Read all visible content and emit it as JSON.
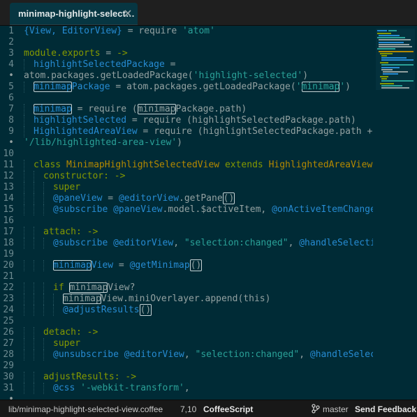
{
  "tab": {
    "title": "minimap-highlight-select…",
    "close_icon": "close-icon"
  },
  "gutter": {
    "lines": [
      "1",
      "2",
      "3",
      "4",
      "•",
      "5",
      "6",
      "7",
      "8",
      "9",
      "•",
      "10",
      "11",
      "12",
      "13",
      "14",
      "15",
      "16",
      "17",
      "18",
      "19",
      "20",
      "21",
      "22",
      "23",
      "24",
      "25",
      "26",
      "27",
      "28",
      "29",
      "30",
      "31",
      "•"
    ]
  },
  "code": {
    "l1": {
      "a": "{View, EditorView}",
      "b": " = require ",
      "c": "'atom'"
    },
    "l3": {
      "a": "module.exports",
      "b": " = ",
      "c": "->"
    },
    "l4": {
      "a": "highlightSelectedPackage",
      "b": " ="
    },
    "l4w": {
      "a": "atom.packages.getLoadedPackage(",
      "b": "'highlight-selected'",
      "c": ")"
    },
    "l5": {
      "a": "minimap",
      "b": "Package",
      "c": " = atom.packages.getLoadedPackage(",
      "d": "'",
      "e": "minimap",
      "f": "'",
      "g": ")"
    },
    "l7": {
      "a": "minimap",
      "b": " = require ",
      "c": "(",
      "d": "minimap",
      "e": "Package.path)"
    },
    "l8": {
      "a": "highlightSelected",
      "b": " = require (highlightSelectedPackage.path)"
    },
    "l9": {
      "a": "HighlightedAreaView",
      "b": " = require (highlightSelectedPackage.path +"
    },
    "l9w": {
      "a": "'/lib/highlighted-area-view'",
      "b": ")"
    },
    "l11": {
      "a": "class ",
      "b": "MinimapHighlightSelectedView",
      "c": " extends ",
      "d": "HighlightedAreaView"
    },
    "l12": {
      "a": "constructor:",
      "b": " ->"
    },
    "l13": {
      "a": "super"
    },
    "l14": {
      "a": "@paneView",
      "b": " = ",
      "c": "@editorView",
      "d": ".getPane",
      "e": "()"
    },
    "l15": {
      "a": "@subscribe ",
      "b": "@paneView",
      "c": ".model.$activeItem, ",
      "d": "@onActiveItemChanged"
    },
    "l17": {
      "a": "attach:",
      "b": " ->"
    },
    "l18": {
      "a": "@subscribe ",
      "b": "@editorView",
      "c": ", ",
      "d": "\"selection:changed\"",
      "e": ", ",
      "f": "@handleSelection"
    },
    "l20": {
      "a": "minimap",
      "b": "View",
      "c": " = ",
      "d": "@getMinimap",
      "e": "()"
    },
    "l22": {
      "a": "if ",
      "b": "minimap",
      "c": "View?"
    },
    "l23": {
      "a": "minimap",
      "b": "View.miniOverlayer.append(this)"
    },
    "l24": {
      "a": "@adjustResults",
      "b": "()"
    },
    "l26": {
      "a": "detach:",
      "b": " ->"
    },
    "l27": {
      "a": "super"
    },
    "l28": {
      "a": "@unsubscribe ",
      "b": "@editorView",
      "c": ", ",
      "d": "\"selection:changed\"",
      "e": ", ",
      "f": "@handleSelection"
    },
    "l30": {
      "a": "adjustResults:",
      "b": " ->"
    },
    "l31": {
      "a": "@css ",
      "b": "'-webkit-transform'",
      "c": ","
    }
  },
  "status": {
    "path": "lib/minimap-highlight-selected-view.coffee",
    "cursor": "7,10",
    "grammar": "CoffeeScript",
    "branch_icon": "git-branch-icon",
    "branch": "master",
    "feedback": "Send Feedback"
  },
  "colors": {
    "background": "#002b36",
    "keyword": "#859900",
    "string": "#2aa198",
    "variable": "#268bd2",
    "class": "#b58900"
  }
}
